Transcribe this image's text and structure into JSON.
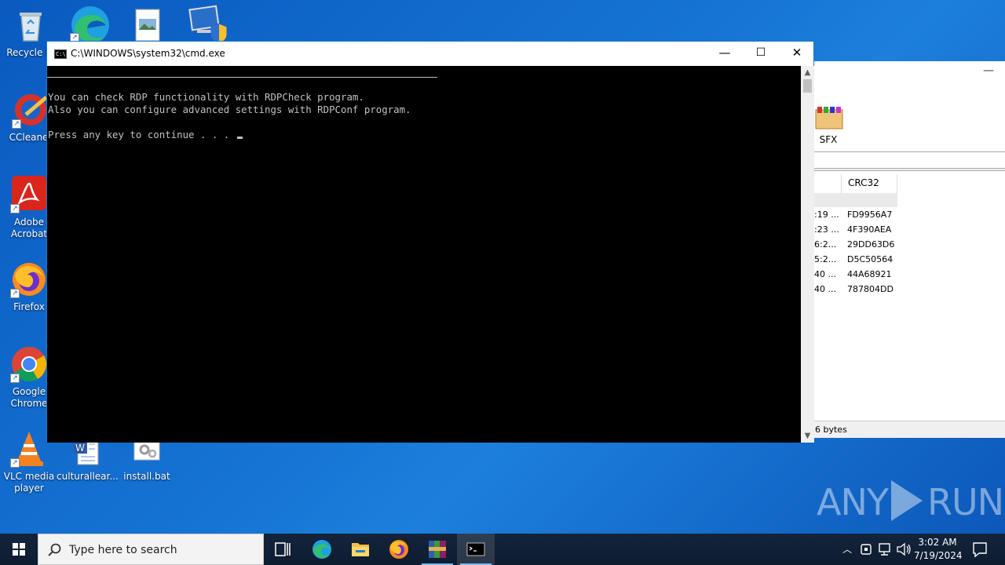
{
  "desktop": {
    "icons": [
      {
        "label": "Recycle Bi"
      },
      {
        "label": "CCleaner"
      },
      {
        "label": "Adobe Acrobat"
      },
      {
        "label": "Firefox"
      },
      {
        "label": "Google Chrome"
      },
      {
        "label": "VLC media player"
      },
      {
        "label": "culturallear..."
      },
      {
        "label": "install.bat"
      }
    ]
  },
  "winrar": {
    "toolbar_sfx": "SFX",
    "column_crc": "CRC32",
    "rows": [
      {
        "date": ":19 ...",
        "crc": "FD9956A7"
      },
      {
        "date": ":23 ...",
        "crc": "4F390AEA"
      },
      {
        "date": "6:2...",
        "crc": "29DD63D6"
      },
      {
        "date": "5:2...",
        "crc": "D5C50564"
      },
      {
        "date": "40 ...",
        "crc": "44A68921"
      },
      {
        "date": "40 ...",
        "crc": "787804DD"
      }
    ],
    "status": "6 bytes"
  },
  "cmd": {
    "title": "C:\\WINDOWS\\system32\\cmd.exe",
    "lines": [
      "You can check RDP functionality with RDPCheck program.",
      "Also you can configure advanced settings with RDPConf program.",
      "",
      "Press any key to continue . . . "
    ],
    "minimize": "—",
    "maximize": "☐",
    "close": "✕"
  },
  "watermark": {
    "left": "ANY",
    "right": "RUN"
  },
  "taskbar": {
    "search_placeholder": "Type here to search",
    "time": "3:02 AM",
    "date": "7/19/2024"
  },
  "colors": {
    "desktop_bg": "#1573d3",
    "taskbar_bg": "#0e1c30",
    "console_bg": "#000000",
    "console_fg": "#c0c0c0"
  }
}
